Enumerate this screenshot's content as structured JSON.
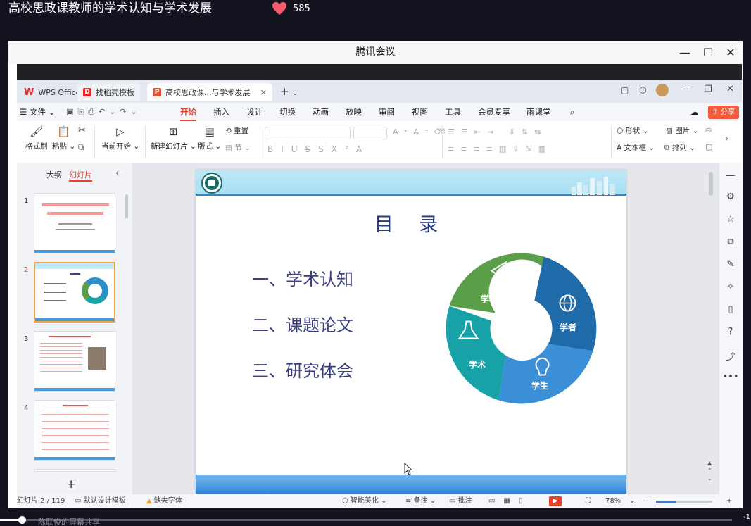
{
  "video": {
    "title": "高校思政课教师的学术认知与学术发展",
    "likes": "585",
    "sharer": "陈联俊的屏幕共享",
    "time_end": "-1",
    "progress": 0.03
  },
  "meeting": {
    "window_title": "腾讯会议"
  },
  "wps": {
    "tabs": [
      {
        "label": "WPS Office"
      },
      {
        "label": "找稻壳模板"
      },
      {
        "label": "高校思政课...与学术发展"
      }
    ],
    "menu": {
      "file": "文件",
      "items": [
        "开始",
        "插入",
        "设计",
        "切换",
        "动画",
        "放映",
        "审阅",
        "视图",
        "工具",
        "会员专享",
        "雨课堂"
      ],
      "share": "分享"
    },
    "ribbon": {
      "format_brush": "格式刷",
      "paste": "粘贴",
      "start_from_current": "当前开始",
      "new_slide": "新建幻灯片",
      "layout": "版式",
      "reset": "重置",
      "section": "节",
      "shape": "形状",
      "picture": "图片",
      "textbox": "文本框",
      "arrange": "排列"
    },
    "left_panel": {
      "tab_outline": "大纲",
      "tab_slides": "幻灯片",
      "thumb_numbers": [
        "1",
        "2",
        "3",
        "4"
      ],
      "add_symbol": "+"
    },
    "slide": {
      "title": "目 录",
      "agenda": [
        "一、学术认知",
        "二、课题论文",
        "三、研究体会"
      ],
      "segments": [
        "学科",
        "学者",
        "学生",
        "学术"
      ]
    },
    "status": {
      "slide_counter": "幻灯片 2 / 119",
      "design_template": "默认设计模板",
      "missing_font": "缺失字体",
      "smart_beautify": "智能美化",
      "notes": "备注",
      "comments": "批注",
      "zoom": "78%"
    }
  },
  "colors": {
    "accent_red": "#e8412b",
    "slide_blue": "#2f86c9",
    "seg_green": "#5a9e4a",
    "seg_blue": "#1f6aa8",
    "seg_light_blue": "#3a8fd6",
    "seg_teal": "#17a2a8"
  }
}
